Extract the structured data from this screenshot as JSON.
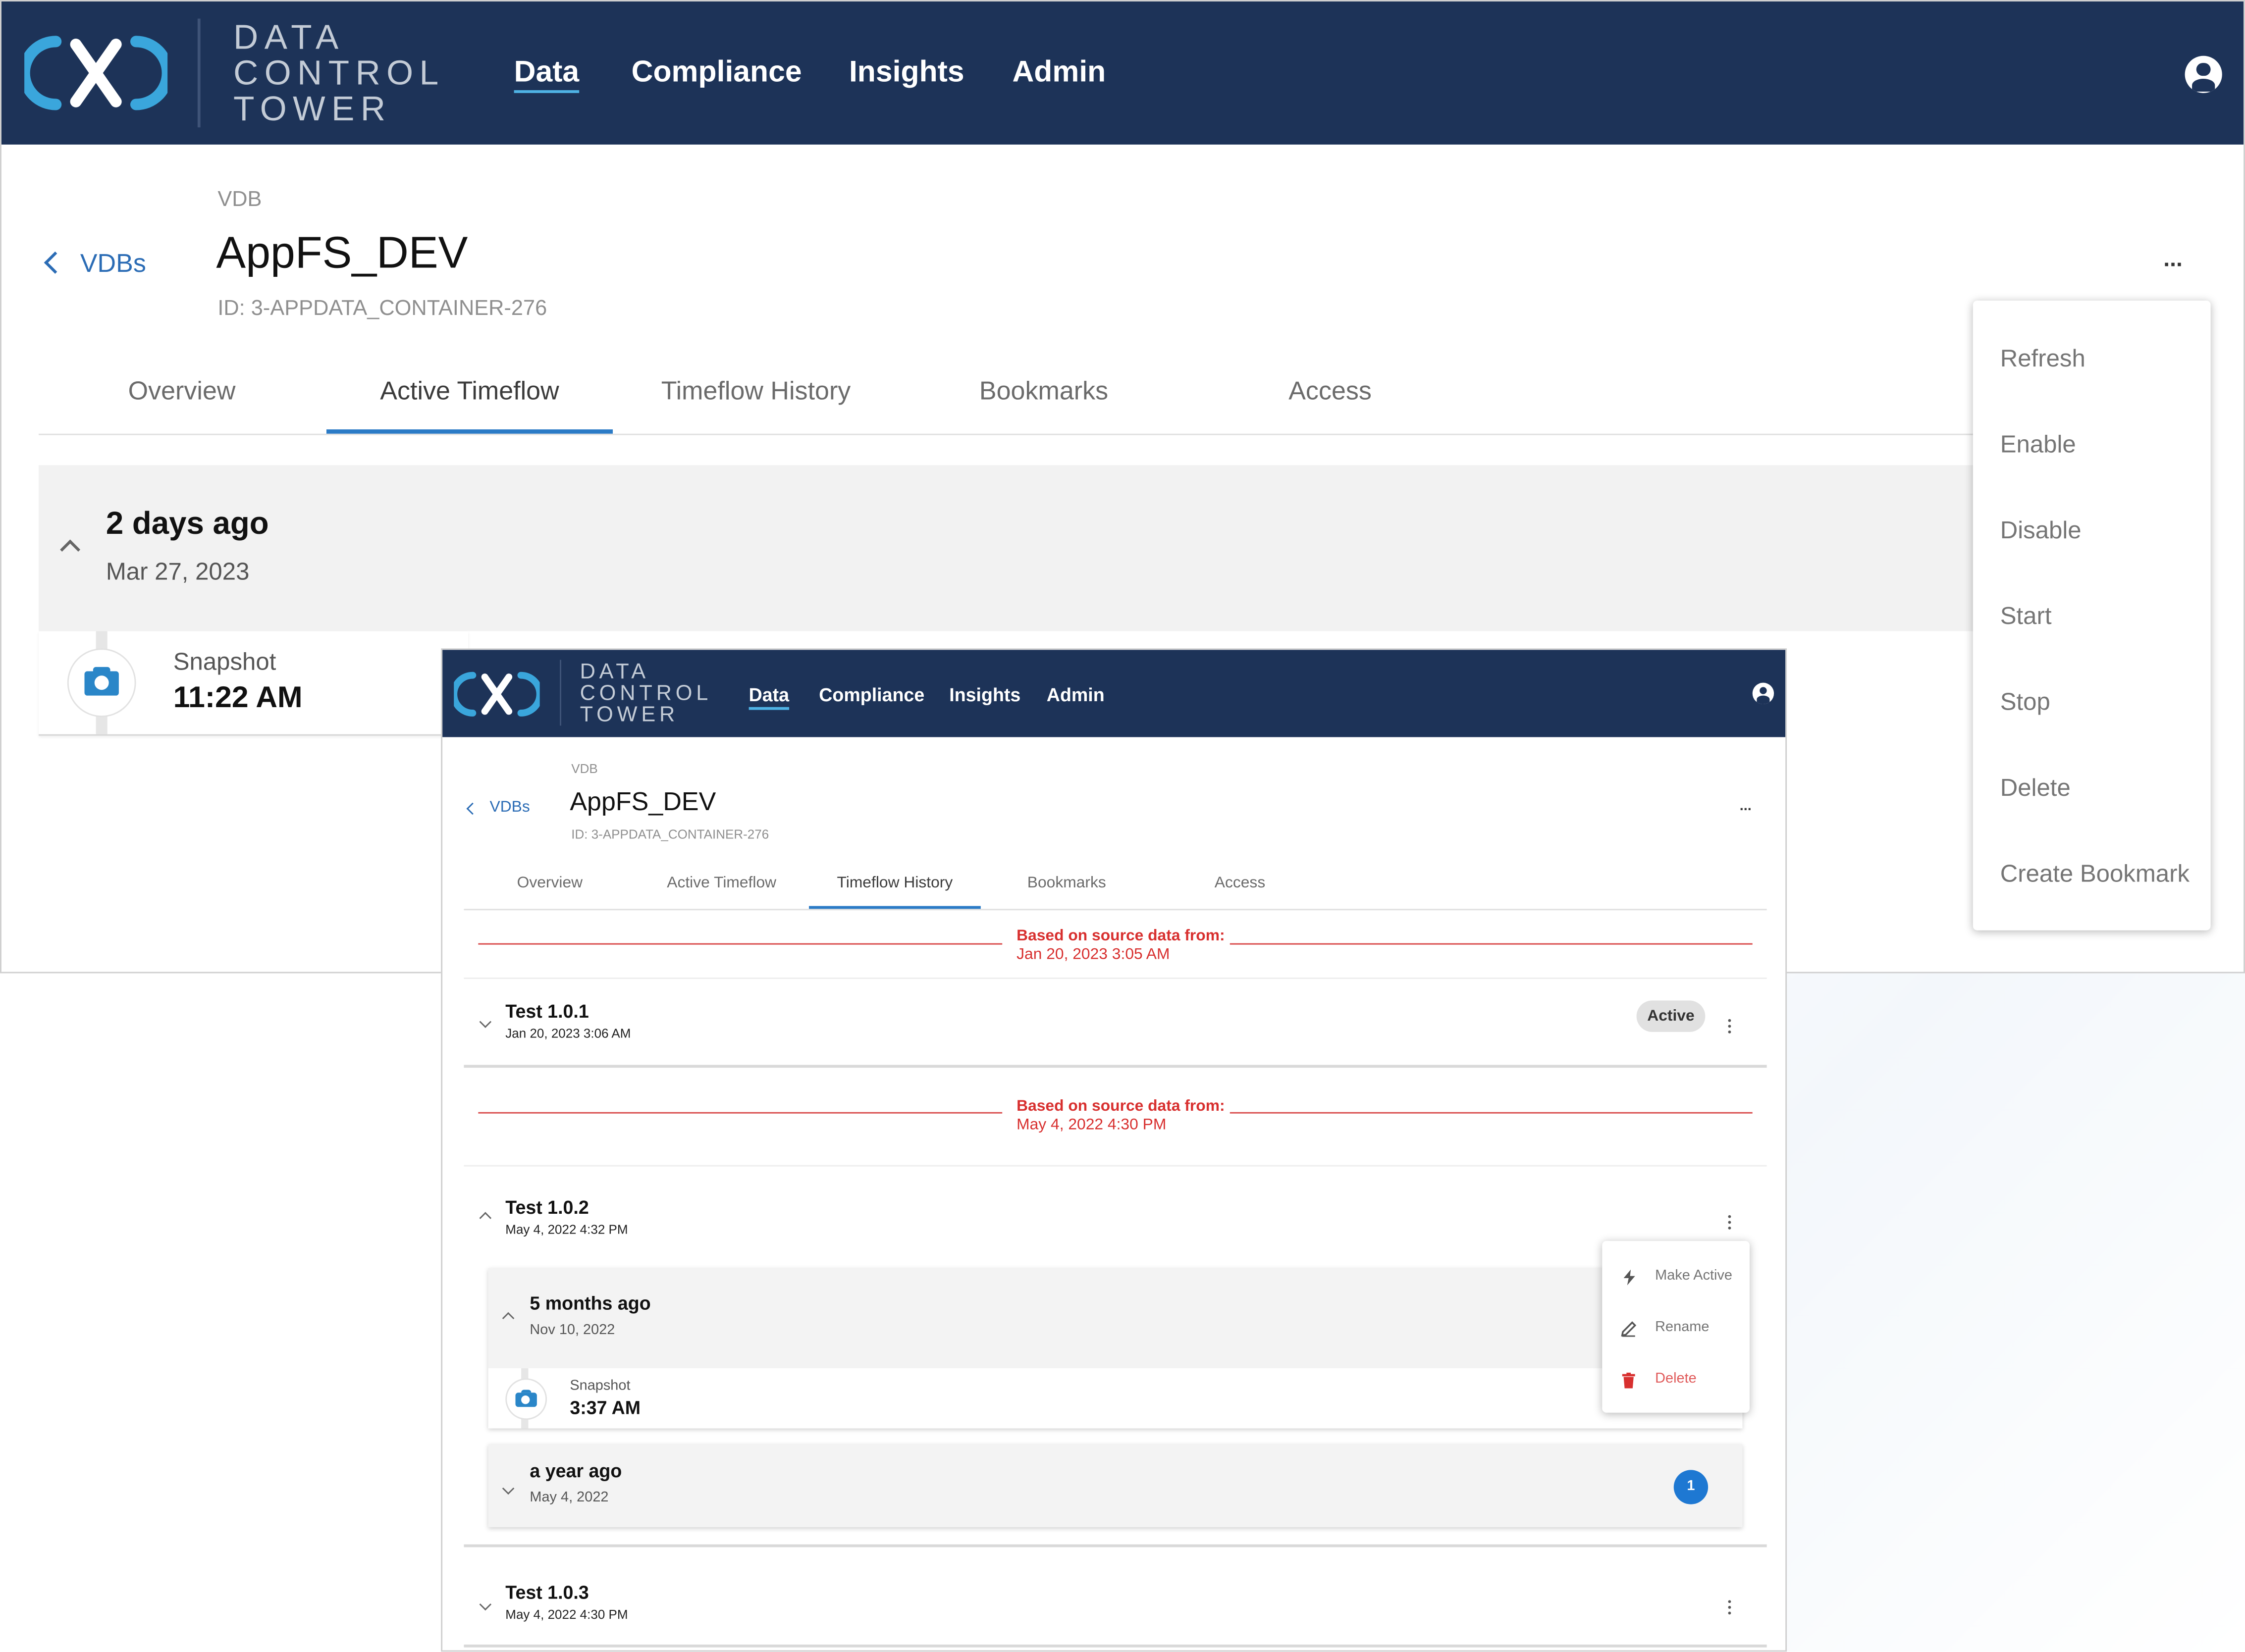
{
  "brand": {
    "line1": "DATA",
    "line2": "CONTROL",
    "line3": "TOWER"
  },
  "nav": [
    "Data",
    "Compliance",
    "Insights",
    "Admin"
  ],
  "page": {
    "kind": "VDB",
    "back_label": "VDBs",
    "title": "AppFS_DEV",
    "id": "ID: 3-APPDATA_CONTAINER-276",
    "more": "..."
  },
  "tabs": [
    "Overview",
    "Active Timeflow",
    "Timeflow History",
    "Bookmarks",
    "Access"
  ],
  "back_window": {
    "active_tab": "Active Timeflow",
    "group": {
      "relative": "2 days ago",
      "date": "Mar 27, 2023"
    },
    "snapshot": {
      "label": "Snapshot",
      "time": "11:22 AM"
    },
    "menu": [
      "Refresh",
      "Enable",
      "Disable",
      "Start",
      "Stop",
      "Delete",
      "Create Bookmark"
    ]
  },
  "front_window": {
    "active_tab": "Timeflow History",
    "source_label": "Based on source data from:",
    "source1_date": "Jan 20, 2023 3:05 AM",
    "source2_date": "May 4, 2022 4:30 PM",
    "timeflows": [
      {
        "name": "Test 1.0.1",
        "date": "Jan 20, 2023 3:06 AM",
        "status": "Active"
      },
      {
        "name": "Test 1.0.2",
        "date": "May 4, 2022 4:32 PM"
      },
      {
        "name": "Test 1.0.3",
        "date": "May 4, 2022 4:30 PM"
      }
    ],
    "group1": {
      "relative": "5 months ago",
      "date": "Nov 10, 2022"
    },
    "snapshot": {
      "label": "Snapshot",
      "time": "3:37 AM"
    },
    "group2": {
      "relative": "a year ago",
      "date": "May 4, 2022",
      "count": "1"
    },
    "menu": [
      {
        "label": "Make Active",
        "icon": "lightning-icon"
      },
      {
        "label": "Rename",
        "icon": "pencil-icon"
      },
      {
        "label": "Delete",
        "icon": "trash-icon"
      }
    ]
  },
  "colors": {
    "navbar": "#1d3358",
    "accent": "#2b7bc6",
    "logo": "#3aa6dc",
    "danger": "#d8302f",
    "badge": "#1e78d2"
  }
}
